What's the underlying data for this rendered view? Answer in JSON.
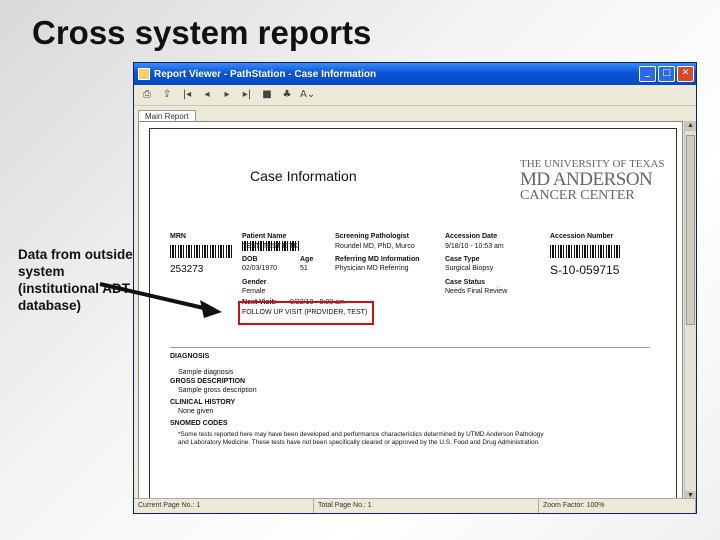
{
  "slide": {
    "title": "Cross system reports",
    "note": "Data from outside system (institutional ADT database)"
  },
  "window": {
    "title": "Report Viewer - PathStation - Case Information",
    "buttons": [
      "_",
      "□",
      "✕"
    ],
    "tab_label": "Main Report"
  },
  "toolbar": {
    "icons": [
      "print-icon",
      "export-icon",
      "first-page-icon",
      "prev-page-icon",
      "next-page-icon",
      "last-page-icon",
      "stop-icon",
      "search-icon",
      "zoom-icon"
    ],
    "glyphs": [
      "⎙",
      "⇪",
      "|◂",
      "◂",
      "▸",
      "▸|",
      "■",
      "♣",
      "A⌄"
    ]
  },
  "report": {
    "heading": "Case Information",
    "logo": {
      "line1": "THE UNIVERSITY OF TEXAS",
      "line2": "MD ANDERSON",
      "line3": "CANCER CENTER"
    },
    "fields": {
      "mrn_label": "MRN",
      "mrn_value": "253273",
      "patient_name_label": "Patient Name",
      "patient_name_value": "TEST, TEST E TK",
      "dob_label": "DOB",
      "dob_value": "02/03/1970",
      "age_label": "Age",
      "age_value": "51",
      "gender_label": "Gender",
      "gender_value": "Female",
      "next_visit_label": "Next Visit:",
      "next_visit_value": "9/22/10 - 9:00 am",
      "next_visit_type": "FOLLOW UP VISIT (PROVIDER, TEST)",
      "screening_label": "Screening Pathologist",
      "screening_value": "Roundel MD, PhD, Murco",
      "referring_label": "Referring MD Information",
      "referring_value": "Physician MD Referring",
      "accession_date_label": "Accession Date",
      "accession_date_value": "9/18/10 - 10:53 am",
      "case_type_label": "Case Type",
      "case_type_value": "Surgical Biopsy",
      "case_status_label": "Case Status",
      "case_status_value": "Needs Final Review",
      "accession_number_label": "Accession Number",
      "accession_number_value": "S-10-059715"
    },
    "sections": {
      "diagnosis_label": "DIAGNOSIS",
      "diagnosis_value": "Sample diagnosis",
      "gross_label": "GROSS DESCRIPTION",
      "gross_value": "Sample gross description",
      "clinical_label": "CLINICAL HISTORY",
      "clinical_value": "None given",
      "snomed_label": "SNOMED CODES",
      "disclaimer_line1": "*Some tests reported here may have been developed and performance characteristics determined by UTMD Anderson Pathology",
      "disclaimer_line2": "and Laboratory Medicine. These tests have not been specifically cleared or approved by the U.S. Food and Drug Administration."
    }
  },
  "statusbar": {
    "current_page": "Current Page No.: 1",
    "total_page": "Total Page No.: 1",
    "zoom": "Zoom Factor: 100%"
  },
  "colors": {
    "highlight_box": "#d01010",
    "titlebar": "#0a55d8"
  }
}
